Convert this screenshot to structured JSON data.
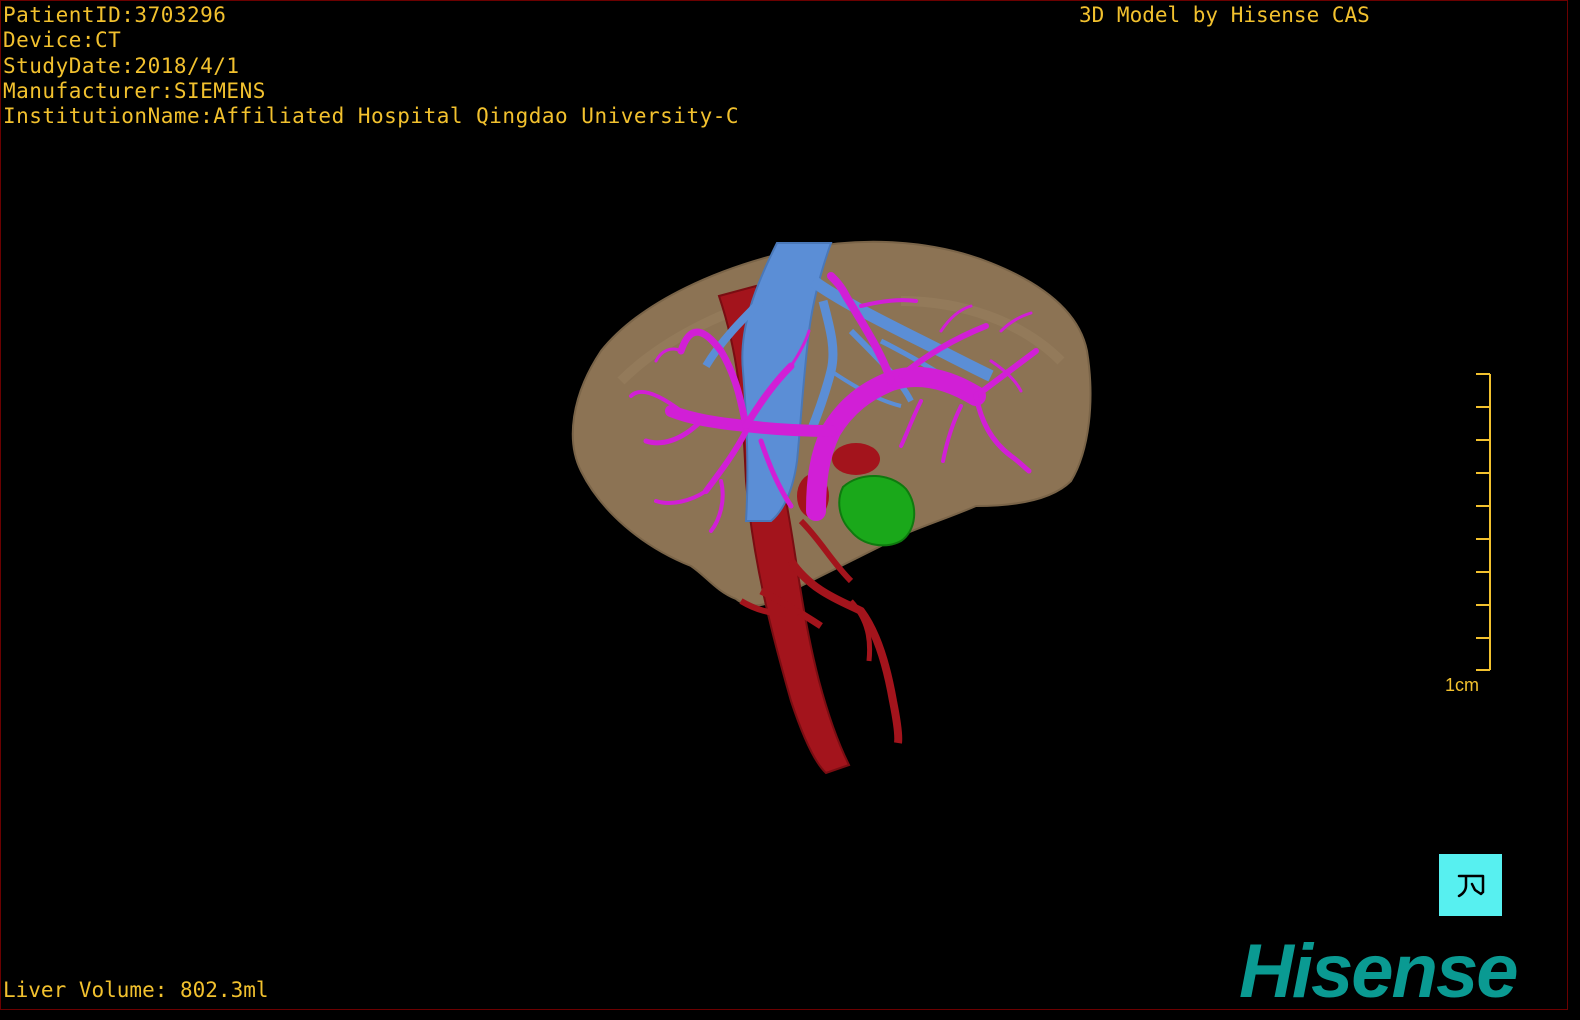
{
  "header": {
    "patient_id": "PatientID:3703296",
    "device": "Device:CT",
    "study_date": "StudyDate:2018/4/1",
    "manufacturer": "Manufacturer:SIEMENS",
    "institution": "InstitutionName:Affiliated Hospital Qingdao University-C"
  },
  "credit": "3D Model by Hisense CAS",
  "footer": {
    "liver_volume": "Liver Volume: 802.3ml"
  },
  "scale_bar": {
    "label": "1cm",
    "ticks": 10
  },
  "orientation_button": {
    "icon": "orientation-figure-icon"
  },
  "brand": {
    "logo_text": "Hisense"
  },
  "colors": {
    "overlay_text": "#f2c12e",
    "liver": "#8c7354",
    "portal_vein": "#d11fd6",
    "hepatic_vein": "#5b8ed6",
    "artery": "#a3141c",
    "lesion": "#1aa81a",
    "orientation_bg": "#57f0f0",
    "brand": "#0a9a92"
  }
}
